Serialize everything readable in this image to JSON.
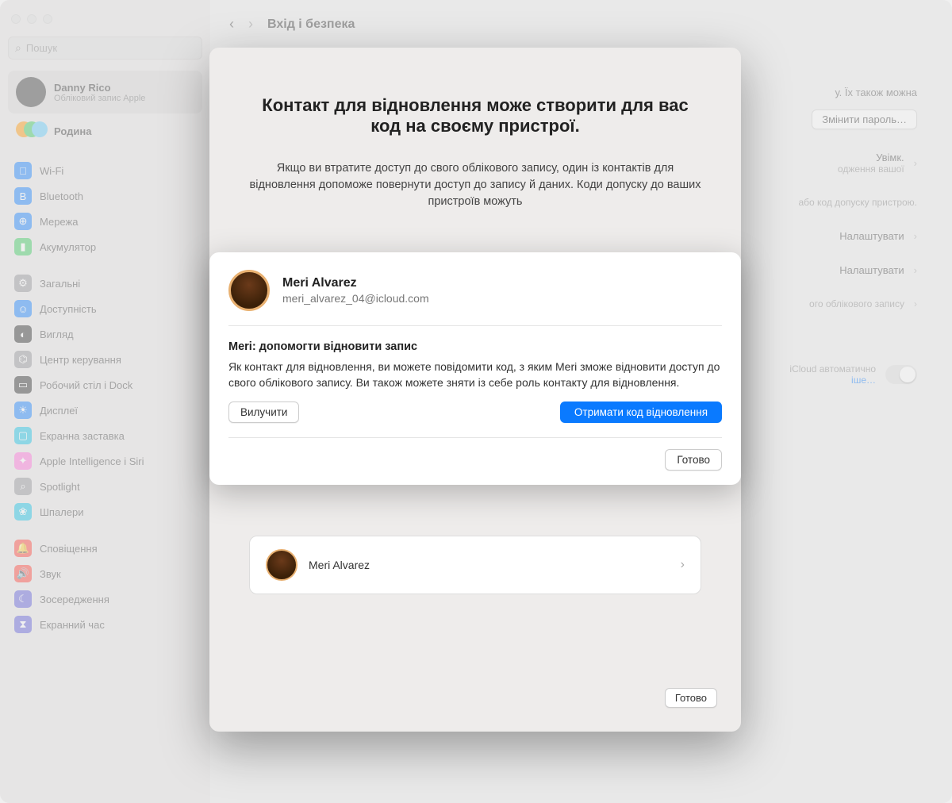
{
  "header": {
    "title": "Вхід і безпека"
  },
  "search": {
    "placeholder": "Пошук"
  },
  "account": {
    "name": "Danny Rico",
    "subtitle": "Обліковий запис Apple"
  },
  "family": {
    "label": "Родина"
  },
  "sidebar": {
    "items": [
      {
        "label": "Wi-Fi",
        "color": "#0a7aff",
        "glyph": "􀙇"
      },
      {
        "label": "Bluetooth",
        "color": "#0a7aff",
        "glyph": "B"
      },
      {
        "label": "Мережа",
        "color": "#0a7aff",
        "glyph": "⊕"
      },
      {
        "label": "Акумулятор",
        "color": "#34c759",
        "glyph": "▮"
      }
    ],
    "items2": [
      {
        "label": "Загальні",
        "color": "#8e8e93",
        "glyph": "⚙"
      },
      {
        "label": "Доступність",
        "color": "#0a7aff",
        "glyph": "☺"
      },
      {
        "label": "Вигляд",
        "color": "#222",
        "glyph": "◐"
      },
      {
        "label": "Центр керування",
        "color": "#8e8e93",
        "glyph": "⌬"
      },
      {
        "label": "Робочий стіл і Dock",
        "color": "#222",
        "glyph": "▭"
      },
      {
        "label": "Дисплеї",
        "color": "#0a7aff",
        "glyph": "☀"
      },
      {
        "label": "Екранна заставка",
        "color": "#0abde3",
        "glyph": "▢"
      },
      {
        "label": "Apple Intelligence і Siri",
        "color": "#ff6bd6",
        "glyph": "✦"
      },
      {
        "label": "Spotlight",
        "color": "#8e8e93",
        "glyph": "⌕"
      },
      {
        "label": "Шпалери",
        "color": "#0abde3",
        "glyph": "❀"
      }
    ],
    "items3": [
      {
        "label": "Сповіщення",
        "color": "#ff3b30",
        "glyph": "🔔"
      },
      {
        "label": "Звук",
        "color": "#ff3b30",
        "glyph": "🔊"
      },
      {
        "label": "Зосередження",
        "color": "#5856d6",
        "glyph": "☾"
      },
      {
        "label": "Екранний час",
        "color": "#5856d6",
        "glyph": "⧗"
      }
    ]
  },
  "main": {
    "hint1": "у. Їх також можна",
    "change_password": "Змінити пароль…",
    "on_label": "Увімк.",
    "on_sub": "одження вашої",
    "passcode_hint": "або код допуску пристрою.",
    "configure": "Налаштувати",
    "account_hint": "ого облікового запису",
    "icloud_hint": "iCloud автоматично",
    "more_link": "іше…",
    "done": "Готово"
  },
  "sheet": {
    "title": "Контакт для відновлення може створити для вас код на своєму пристрої.",
    "description": "Якщо ви втратите доступ до свого облікового запису, один із контактів для відновлення допоможе повернути доступ до запису й даних. Коди допуску до ваших пристроїв можуть",
    "contact_name": "Meri Alvarez",
    "done": "Готово"
  },
  "modal": {
    "name": "Meri Alvarez",
    "email": "meri_alvarez_04@icloud.com",
    "subtitle": "Meri: допомогти відновити запис",
    "body": "Як контакт для відновлення, ви можете повідомити код, з яким Meri зможе відновити доступ до свого облікового запису. Ви також можете зняти із себе роль контакту для відновлення.",
    "remove": "Вилучити",
    "get_code": "Отримати код відновлення",
    "done": "Готово"
  }
}
